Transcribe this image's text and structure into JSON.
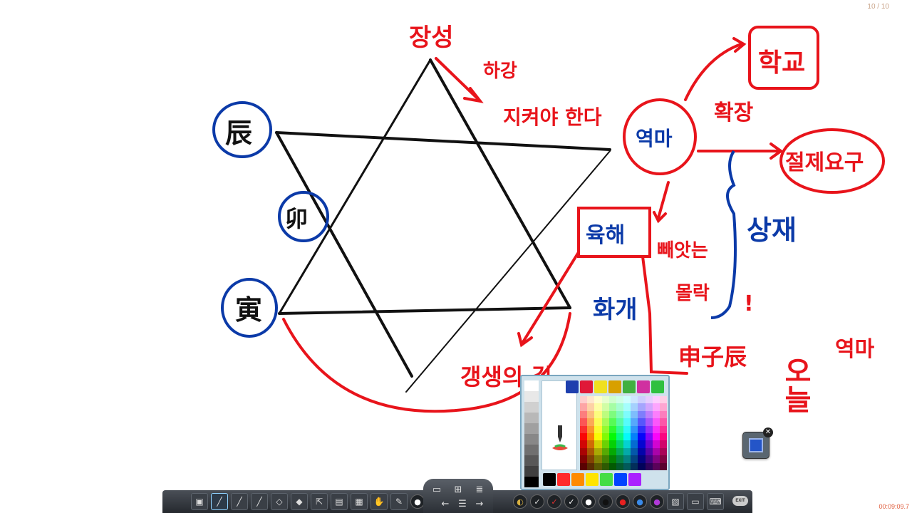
{
  "header": {
    "page_counter": "10 / 10"
  },
  "status": {
    "timer": "00:09:09.7"
  },
  "annotations": {
    "top_label": "장성",
    "descend_label": "하강",
    "must_keep": "지켜야 한다",
    "circle_top": "역마",
    "box_school": "학교",
    "expand": "확장",
    "box_demand": "절제요구",
    "box_flesh": "육해",
    "taken": "빼앗는",
    "short_fall": "몰락",
    "exclaim": "!",
    "side_blue": "상재",
    "hwagae": "화개",
    "bottom_label": "갱생의 길",
    "hanja_bottom": "申子辰",
    "vertical": "오늘",
    "far_right": "역마",
    "left_top": "辰",
    "left_mid": "卯",
    "left_bottom": "寅"
  },
  "palette": {
    "top_colors": [
      "#1d3fae",
      "#e01838",
      "#f0e020",
      "#d8a000",
      "#40b040",
      "#d030a0",
      "#30c040"
    ],
    "bottom_colors": [
      "#000000",
      "#ff2a2a",
      "#ff8a00",
      "#ffe400",
      "#44dd44",
      "#0044ff",
      "#aa22ff"
    ]
  },
  "toolbar": {
    "tools": [
      "window-icon",
      "pen-icon",
      "pen-thin-icon",
      "brush-icon",
      "shape-icon",
      "eraser-icon",
      "pointer-icon",
      "screen-icon",
      "board-icon",
      "hand-icon",
      "highlight-icon"
    ],
    "exit_label": "EXIT"
  },
  "colors": {
    "ink_black": "#111111",
    "ink_red": "#e8141b",
    "ink_blue": "#0b3aa8"
  }
}
